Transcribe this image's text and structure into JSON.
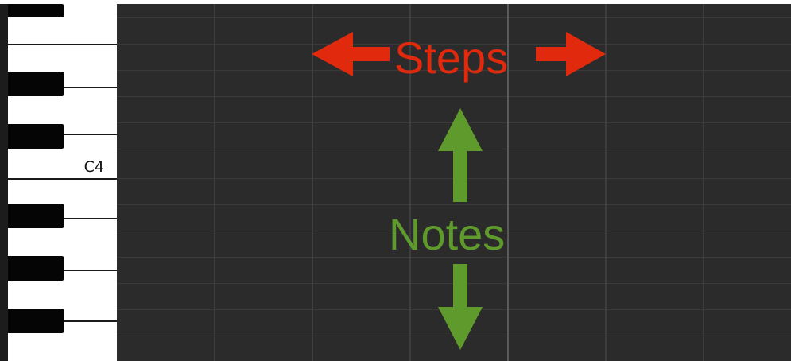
{
  "piano_roll": {
    "key_label": "C4",
    "annotations": {
      "steps_label": "Steps",
      "notes_label": "Notes"
    },
    "colors": {
      "grid_background": "#2b2b2b",
      "grid_line": "#3a3a3a",
      "bar_line": "#555555",
      "steps_accent": "#e0290d",
      "notes_accent": "#5f9a2c",
      "white_key": "#ffffff",
      "black_key": "#050505"
    }
  }
}
